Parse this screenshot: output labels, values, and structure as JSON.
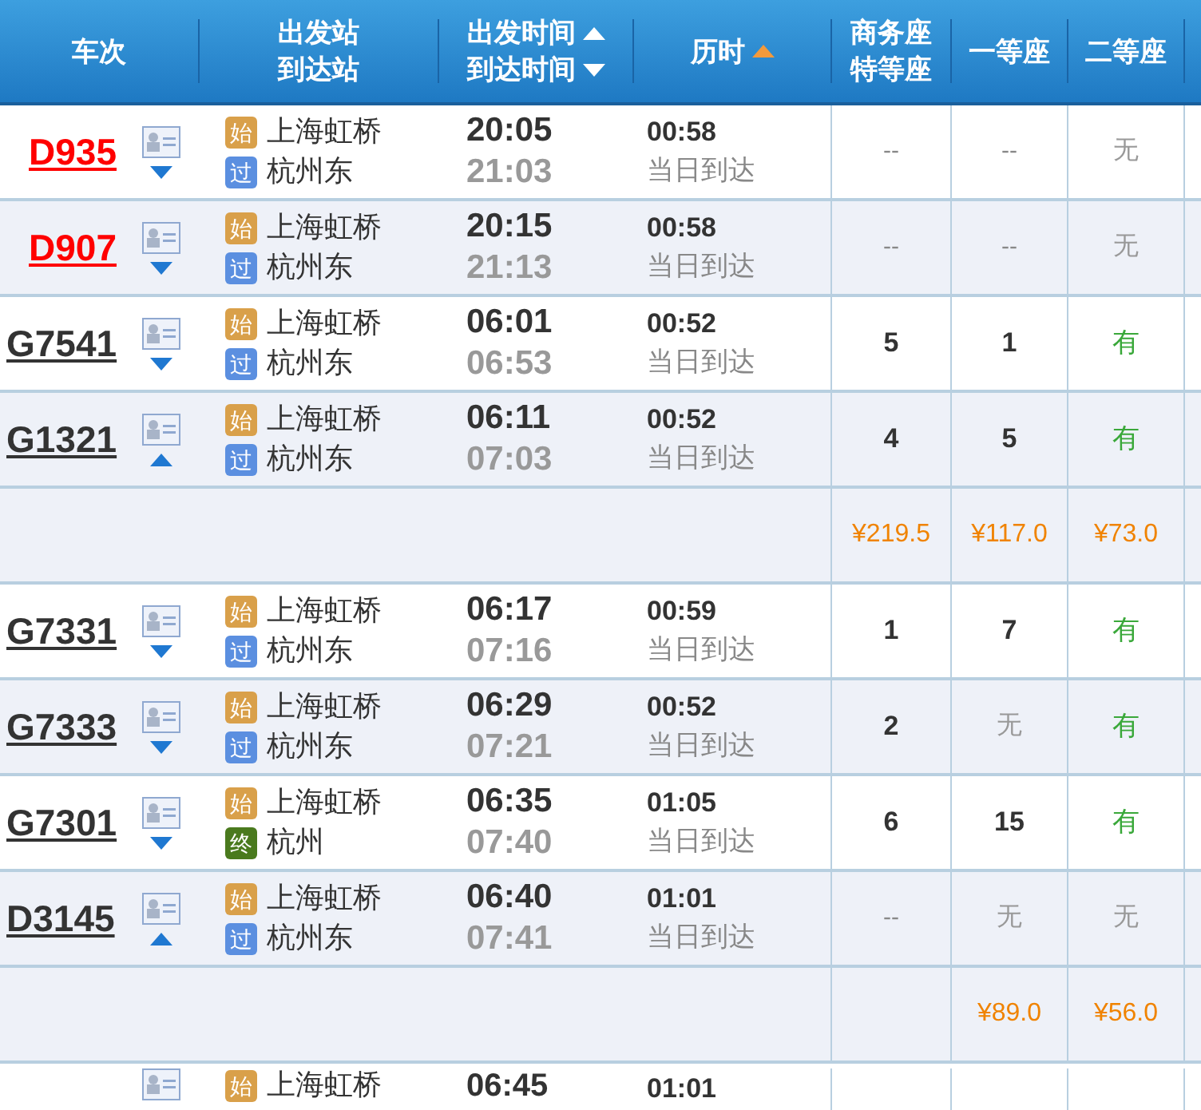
{
  "header": {
    "columns": [
      {
        "lines": [
          "车次"
        ]
      },
      {
        "lines": [
          "出发站",
          "到达站"
        ]
      },
      {
        "lines": [
          "出发时间",
          "到达时间"
        ],
        "sort_arrows": [
          {
            "kind": "up",
            "active": false
          },
          {
            "kind": "down",
            "active": false
          }
        ]
      },
      {
        "lines": [
          "历时"
        ],
        "sort_arrows": [
          {
            "kind": "up",
            "active": true
          }
        ]
      },
      {
        "lines": [
          "商务座",
          "特等座"
        ]
      },
      {
        "lines": [
          "一等座"
        ]
      },
      {
        "lines": [
          "二等座"
        ]
      }
    ]
  },
  "rows": [
    {
      "kind": "train",
      "train": "D935",
      "highlight": true,
      "expanded": false,
      "from": {
        "badge": "始",
        "kind": "start",
        "name": "上海虹桥"
      },
      "to": {
        "badge": "过",
        "kind": "pass",
        "name": "杭州东"
      },
      "depart": "20:05",
      "arrive": "21:03",
      "duration": "00:58",
      "arrival_day": "当日到达",
      "seats": [
        {
          "text": "--",
          "kind": "na"
        },
        {
          "text": "--",
          "kind": "na"
        },
        {
          "text": "无",
          "kind": "none"
        }
      ]
    },
    {
      "kind": "train",
      "train": "D907",
      "highlight": true,
      "expanded": false,
      "from": {
        "badge": "始",
        "kind": "start",
        "name": "上海虹桥"
      },
      "to": {
        "badge": "过",
        "kind": "pass",
        "name": "杭州东"
      },
      "depart": "20:15",
      "arrive": "21:13",
      "duration": "00:58",
      "arrival_day": "当日到达",
      "seats": [
        {
          "text": "--",
          "kind": "na"
        },
        {
          "text": "--",
          "kind": "na"
        },
        {
          "text": "无",
          "kind": "none"
        }
      ]
    },
    {
      "kind": "train",
      "train": "G7541",
      "highlight": false,
      "expanded": false,
      "from": {
        "badge": "始",
        "kind": "start",
        "name": "上海虹桥"
      },
      "to": {
        "badge": "过",
        "kind": "pass",
        "name": "杭州东"
      },
      "depart": "06:01",
      "arrive": "06:53",
      "duration": "00:52",
      "arrival_day": "当日到达",
      "seats": [
        {
          "text": "5",
          "kind": "count"
        },
        {
          "text": "1",
          "kind": "count"
        },
        {
          "text": "有",
          "kind": "available"
        }
      ]
    },
    {
      "kind": "train",
      "train": "G1321",
      "highlight": false,
      "expanded": true,
      "from": {
        "badge": "始",
        "kind": "start",
        "name": "上海虹桥"
      },
      "to": {
        "badge": "过",
        "kind": "pass",
        "name": "杭州东"
      },
      "depart": "06:11",
      "arrive": "07:03",
      "duration": "00:52",
      "arrival_day": "当日到达",
      "seats": [
        {
          "text": "4",
          "kind": "count"
        },
        {
          "text": "5",
          "kind": "count"
        },
        {
          "text": "有",
          "kind": "available"
        }
      ]
    },
    {
      "kind": "prices",
      "prices": {
        "business": "¥219.5",
        "first": "¥117.0",
        "second": "¥73.0"
      }
    },
    {
      "kind": "train",
      "train": "G7331",
      "highlight": false,
      "expanded": false,
      "from": {
        "badge": "始",
        "kind": "start",
        "name": "上海虹桥"
      },
      "to": {
        "badge": "过",
        "kind": "pass",
        "name": "杭州东"
      },
      "depart": "06:17",
      "arrive": "07:16",
      "duration": "00:59",
      "arrival_day": "当日到达",
      "seats": [
        {
          "text": "1",
          "kind": "count"
        },
        {
          "text": "7",
          "kind": "count"
        },
        {
          "text": "有",
          "kind": "available"
        }
      ]
    },
    {
      "kind": "train",
      "train": "G7333",
      "highlight": false,
      "expanded": false,
      "from": {
        "badge": "始",
        "kind": "start",
        "name": "上海虹桥"
      },
      "to": {
        "badge": "过",
        "kind": "pass",
        "name": "杭州东"
      },
      "depart": "06:29",
      "arrive": "07:21",
      "duration": "00:52",
      "arrival_day": "当日到达",
      "seats": [
        {
          "text": "2",
          "kind": "count"
        },
        {
          "text": "无",
          "kind": "none"
        },
        {
          "text": "有",
          "kind": "available"
        }
      ]
    },
    {
      "kind": "train",
      "train": "G7301",
      "highlight": false,
      "expanded": false,
      "from": {
        "badge": "始",
        "kind": "start",
        "name": "上海虹桥"
      },
      "to": {
        "badge": "终",
        "kind": "end",
        "name": "杭州"
      },
      "depart": "06:35",
      "arrive": "07:40",
      "duration": "01:05",
      "arrival_day": "当日到达",
      "seats": [
        {
          "text": "6",
          "kind": "count"
        },
        {
          "text": "15",
          "kind": "count"
        },
        {
          "text": "有",
          "kind": "available"
        }
      ]
    },
    {
      "kind": "train",
      "train": "D3145",
      "highlight": false,
      "expanded": true,
      "from": {
        "badge": "始",
        "kind": "start",
        "name": "上海虹桥"
      },
      "to": {
        "badge": "过",
        "kind": "pass",
        "name": "杭州东"
      },
      "depart": "06:40",
      "arrive": "07:41",
      "duration": "01:01",
      "arrival_day": "当日到达",
      "seats": [
        {
          "text": "--",
          "kind": "na"
        },
        {
          "text": "无",
          "kind": "none"
        },
        {
          "text": "无",
          "kind": "none"
        }
      ]
    },
    {
      "kind": "prices",
      "prices": {
        "first": "¥89.0",
        "second": "¥56.0"
      }
    },
    {
      "kind": "partial",
      "from": {
        "badge": "始",
        "kind": "start",
        "name": "上海虹桥"
      },
      "depart": "06:45",
      "duration": "01:01"
    }
  ]
}
